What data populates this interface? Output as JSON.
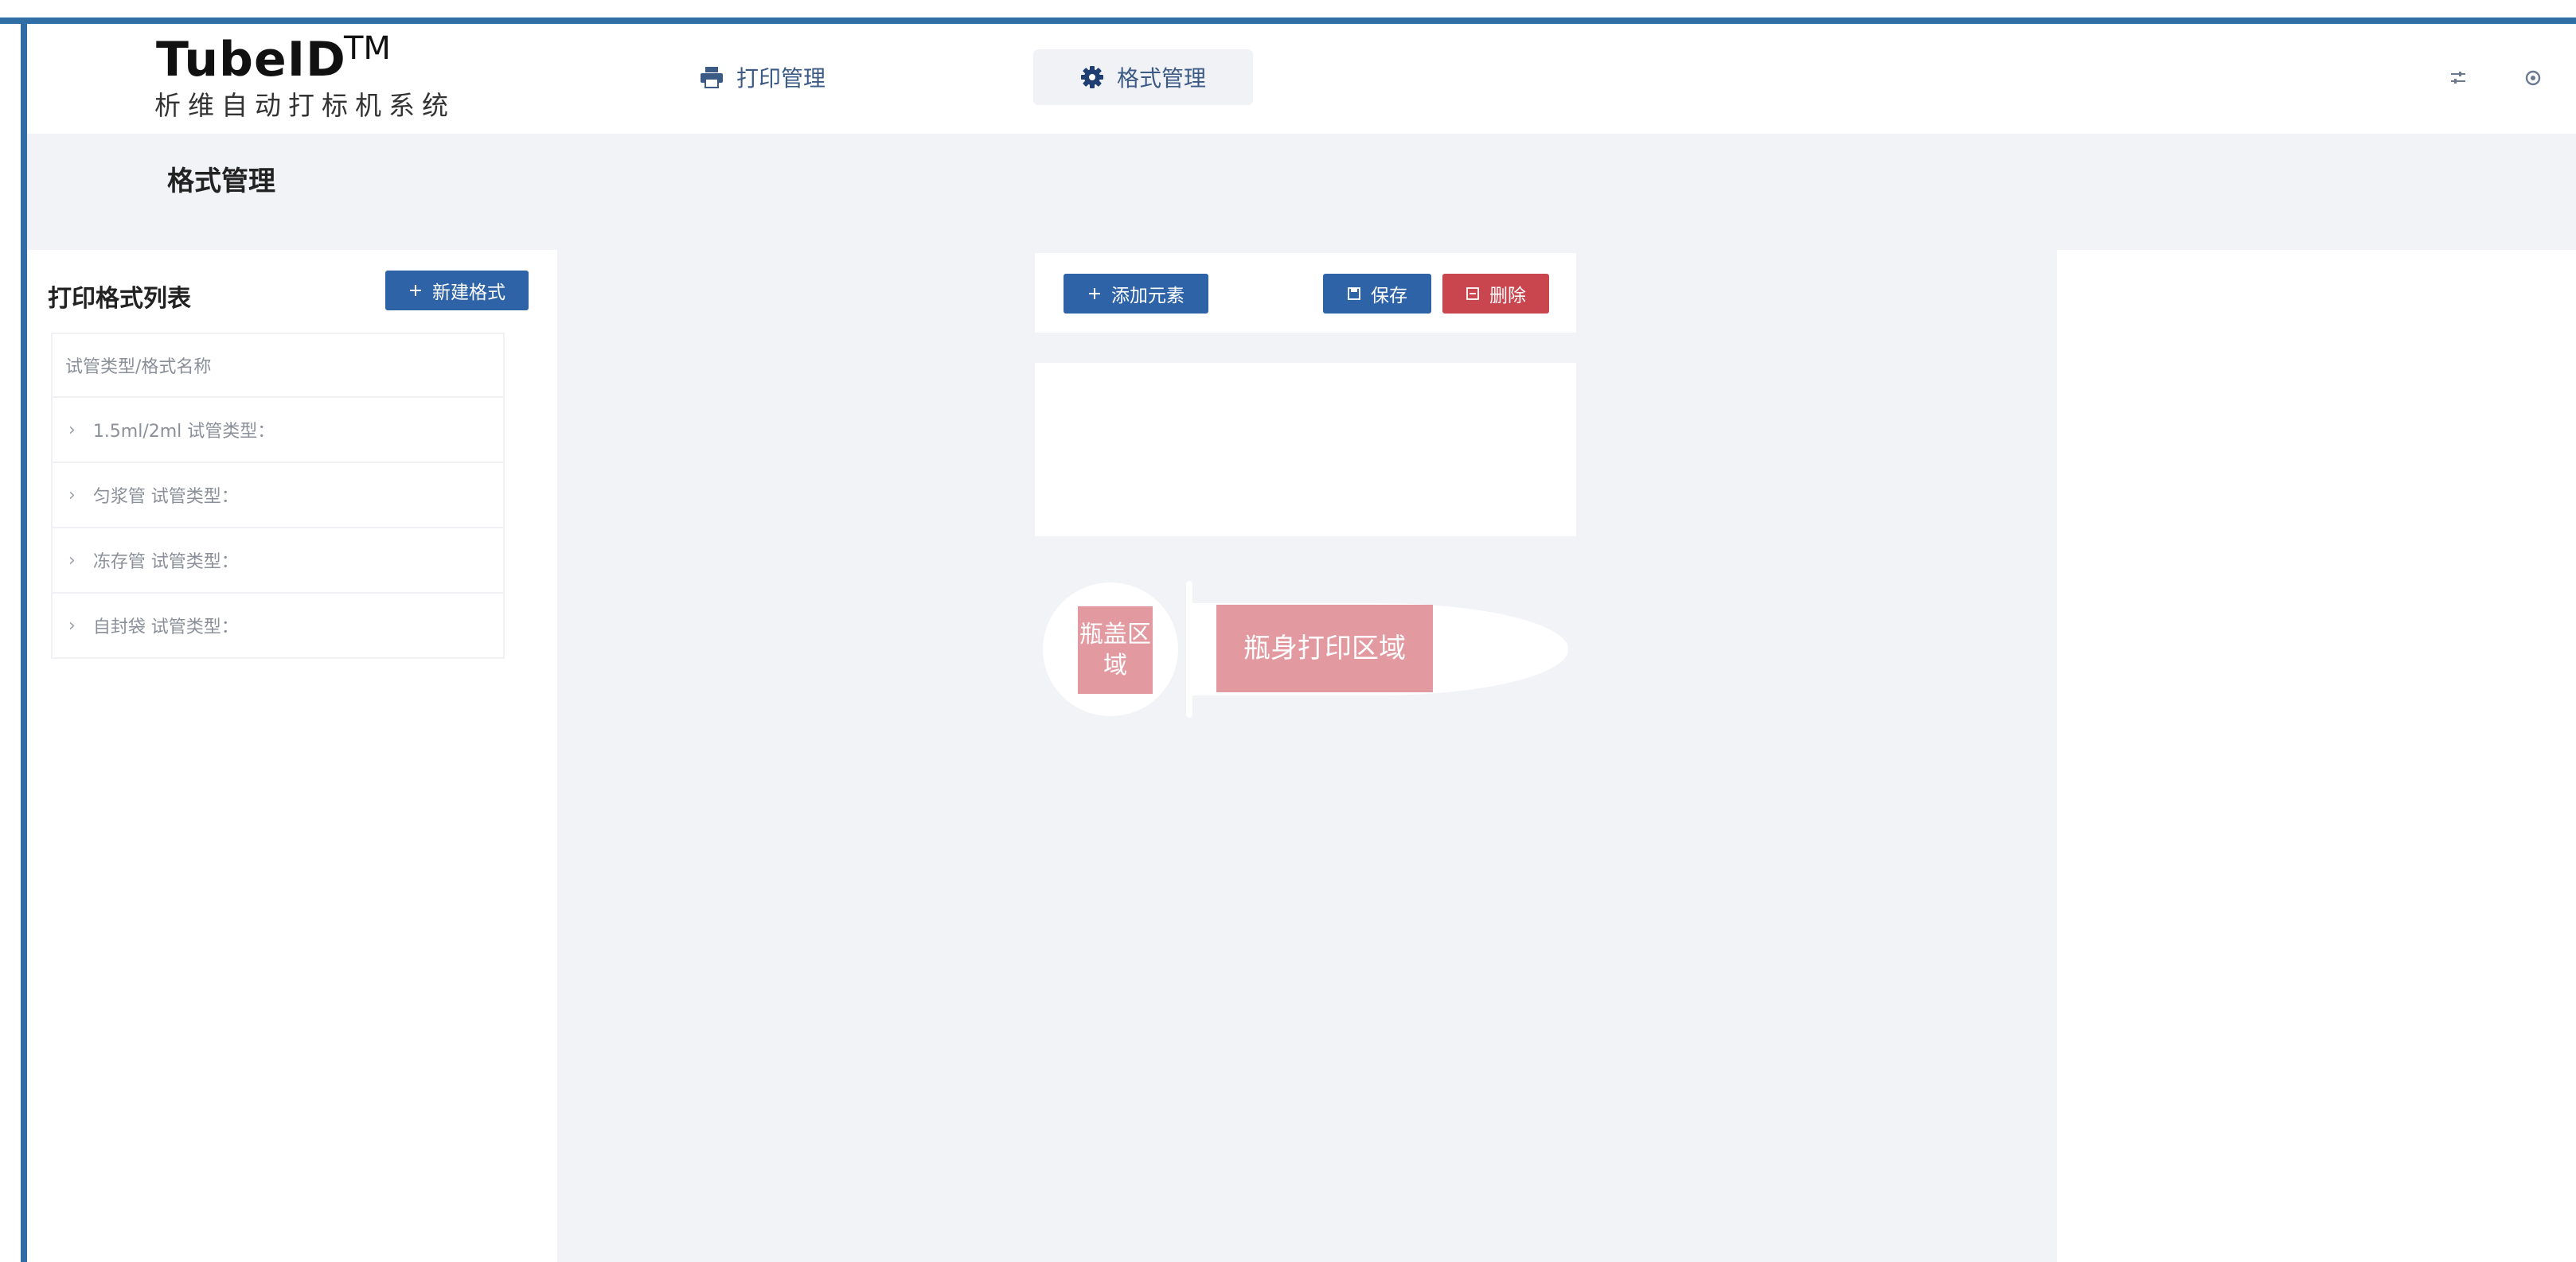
{
  "app": {
    "title": "TubeID",
    "trademark": "TM",
    "subtitle": "析维自动打标机系统"
  },
  "nav": [
    {
      "label": "打印管理",
      "icon": "printer-icon",
      "active": false
    },
    {
      "label": "格式管理",
      "icon": "gear-icon",
      "active": true
    }
  ],
  "header_icons": [
    "sliders-icon",
    "settings-icon"
  ],
  "page": {
    "title": "格式管理"
  },
  "left_panel": {
    "title": "打印格式列表",
    "new_button": "新建格式",
    "list_header": "试管类型/格式名称",
    "items": [
      "1.5ml/2ml 试管类型：",
      "匀浆管 试管类型：",
      "冻存管 试管类型：",
      "自封袋 试管类型："
    ]
  },
  "toolbar": {
    "add_button": "添加元素",
    "save_button": "保存",
    "delete_button": "删除"
  },
  "tube": {
    "cap_zone": "瓶盖区域",
    "body_zone": "瓶身打印区域"
  },
  "colors": {
    "primary": "#2f63a7",
    "danger": "#c9464f",
    "zone": "#e29aa0",
    "frame": "#2f6fa6"
  }
}
